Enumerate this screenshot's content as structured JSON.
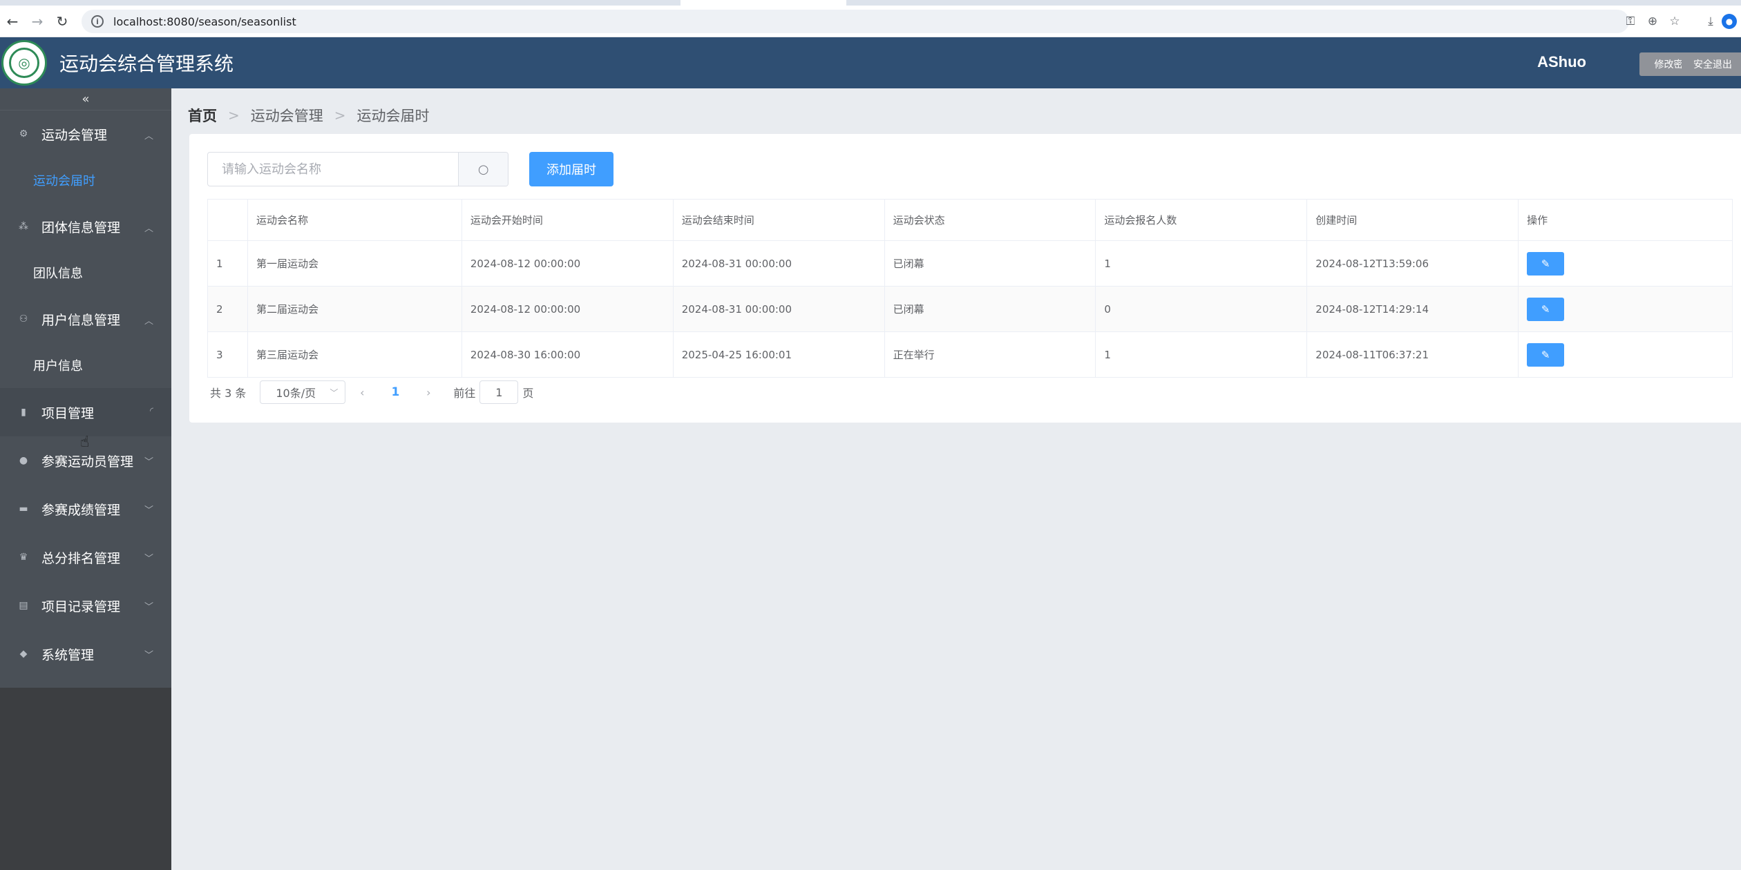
{
  "browser": {
    "url": "localhost:8080/season/seasonlist",
    "back_glyph": "←",
    "forward_glyph": "→",
    "reload_glyph": "↻",
    "info_glyph": "i",
    "key_glyph": "⚿",
    "zoom_glyph": "⊕",
    "star_glyph": "☆",
    "download_glyph": "⤓",
    "profile_glyph": "●"
  },
  "header": {
    "title": "运动会综合管理系统",
    "user": "AShuo",
    "change_password": "修改密码",
    "logout": "安全退出",
    "logo_glyph": "◎"
  },
  "sidebar": {
    "collapse_glyph": "«",
    "groups": [
      {
        "label": "运动会管理",
        "icon": "gear-cluster-icon",
        "expanded": true,
        "sub": [
          "运动会届时"
        ]
      },
      {
        "label": "团体信息管理",
        "icon": "group-icon",
        "expanded": true,
        "sub": [
          "团队信息"
        ]
      },
      {
        "label": "用户信息管理",
        "icon": "users-icon",
        "expanded": true,
        "sub": [
          "用户信息"
        ]
      },
      {
        "label": "项目管理",
        "icon": "document-icon",
        "expanded": false
      },
      {
        "label": "参赛运动员管理",
        "icon": "user-icon",
        "expanded": false
      },
      {
        "label": "参赛成绩管理",
        "icon": "folder-icon",
        "expanded": false
      },
      {
        "label": "总分排名管理",
        "icon": "trophy-icon",
        "expanded": false
      },
      {
        "label": "项目记录管理",
        "icon": "record-icon",
        "expanded": false
      },
      {
        "label": "系统管理",
        "icon": "box-icon",
        "expanded": false
      }
    ],
    "glyphs": {
      "up": "︿",
      "down": "﹀",
      "loading": "◜",
      "gear": "⚙",
      "group": "⁂",
      "users": "⚇",
      "doc": "▮",
      "user": "●",
      "folder": "▬",
      "trophy": "♛",
      "record": "▤",
      "box": "◆"
    }
  },
  "breadcrumb": {
    "home": "首页",
    "level1": "运动会管理",
    "level2": "运动会届时",
    "sep": ">"
  },
  "toolbar": {
    "search_placeholder": "请输入运动会名称",
    "search_glyph": "○",
    "add_label": "添加届时"
  },
  "table": {
    "columns": [
      "",
      "运动会名称",
      "运动会开始时间",
      "运动会结束时间",
      "运动会状态",
      "运动会报名人数",
      "创建时间",
      "操作"
    ],
    "rows": [
      {
        "index": "1",
        "name": "第一届运动会",
        "start": "2024-08-12 00:00:00",
        "end": "2024-08-31 00:00:00",
        "status": "已闭幕",
        "count": "1",
        "created": "2024-08-12T13:59:06"
      },
      {
        "index": "2",
        "name": "第二届运动会",
        "start": "2024-08-12 00:00:00",
        "end": "2024-08-31 00:00:00",
        "status": "已闭幕",
        "count": "0",
        "created": "2024-08-12T14:29:14"
      },
      {
        "index": "3",
        "name": "第三届运动会",
        "start": "2024-08-30 16:00:00",
        "end": "2025-04-25 16:00:01",
        "status": "正在举行",
        "count": "1",
        "created": "2024-08-11T06:37:21"
      }
    ],
    "edit_glyph": "✎"
  },
  "pager": {
    "total": "共 3 条",
    "page_size": "10条/页",
    "dropdown_glyph": "﹀",
    "prev_glyph": "‹",
    "next_glyph": "›",
    "current": "1",
    "goto_prefix": "前往",
    "goto_value": "1",
    "goto_suffix": "页"
  },
  "cursor_glyph": "☝"
}
